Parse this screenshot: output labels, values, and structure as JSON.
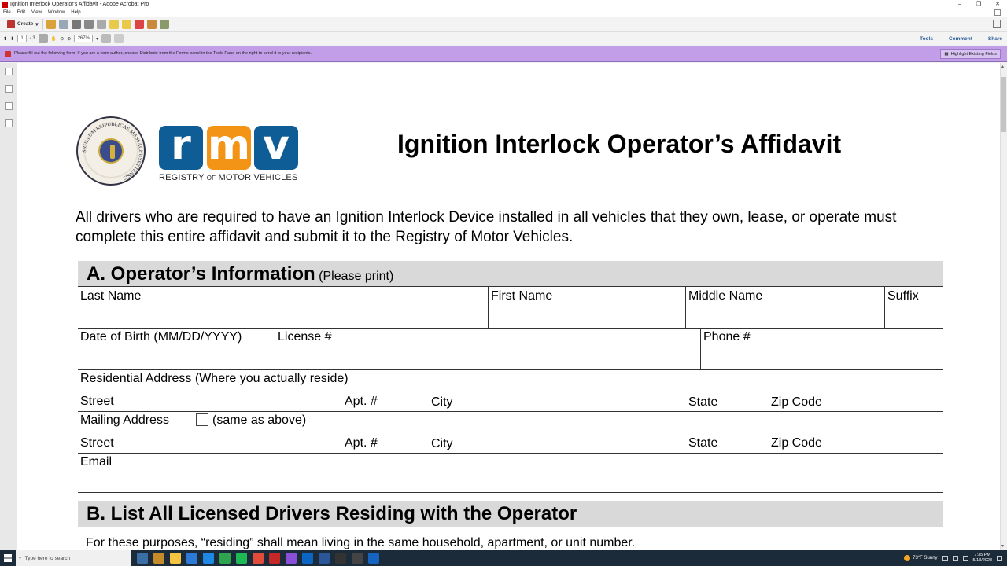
{
  "window": {
    "title": "Ignition Interlock Operator's Affidavit - Adobe Acrobat Pro",
    "controls": [
      "–",
      "❐",
      "✕"
    ]
  },
  "menu": [
    "File",
    "Edit",
    "View",
    "Window",
    "Help"
  ],
  "toolbar": {
    "create_label": "Create",
    "page_current": "1",
    "page_total": "/ 3",
    "zoom": "267%",
    "tools_label": "Tools",
    "comment_label": "Comment",
    "share_label": "Share"
  },
  "formbar": {
    "message": "Please fill out the following form. If you are a form author, choose Distribute from the Forms panel in the Tools Pane on the right to send it to your recipients.",
    "highlight_label": "Highlight Existing Fields",
    "color": "#c29ee8"
  },
  "document": {
    "seal_text": "SIGILLUM REIPUBLICAE MASSACHUSETTENSIS",
    "rmv_letters": [
      "r",
      "m",
      "v"
    ],
    "rmv_sub_1": "REGISTRY ",
    "rmv_sub_of": "OF",
    "rmv_sub_2": " MOTOR VEHICLES",
    "title": "Ignition Interlock Operator’s Affidavit",
    "intro": "All drivers who are required to have an Ignition Interlock Device installed in all vehicles that they own, lease, or operate must complete this entire affidavit and submit it to the Registry of Motor Vehicles.",
    "section_a": {
      "title": "A. Operator’s Information",
      "note": " (Please print)",
      "last_name": "Last Name",
      "first_name": "First Name",
      "middle_name": "Middle Name",
      "suffix": "Suffix",
      "dob": "Date of Birth (MM/DD/YYYY)",
      "license": "License #",
      "phone": "Phone #",
      "residential": "Residential Address (Where you actually reside)",
      "street": "Street",
      "apt": "Apt. #",
      "city": "City",
      "state": "State",
      "zip": "Zip Code",
      "mailing": "Mailing Address",
      "same_as_above": "(same as above)",
      "email": "Email"
    },
    "section_b": {
      "title": "B. List All Licensed Drivers Residing with the Operator",
      "note": "For these purposes, “residing” shall mean living in the same household, apartment, or unit number."
    }
  },
  "taskbar": {
    "search_placeholder": "Type here to search",
    "weather": "73°F Sunny",
    "time": "7:35 PM",
    "date": "5/13/2023",
    "apps": [
      "#3a6ea5",
      "#c58b2b",
      "#f5c542",
      "#2d7ad6",
      "#1e88e5",
      "#2ea44f",
      "#1db954",
      "#e04b3a",
      "#c62828",
      "#8a4fd8",
      "#0a66c2",
      "#2b579a",
      "#333333",
      "#444444",
      "#1565c0"
    ]
  }
}
